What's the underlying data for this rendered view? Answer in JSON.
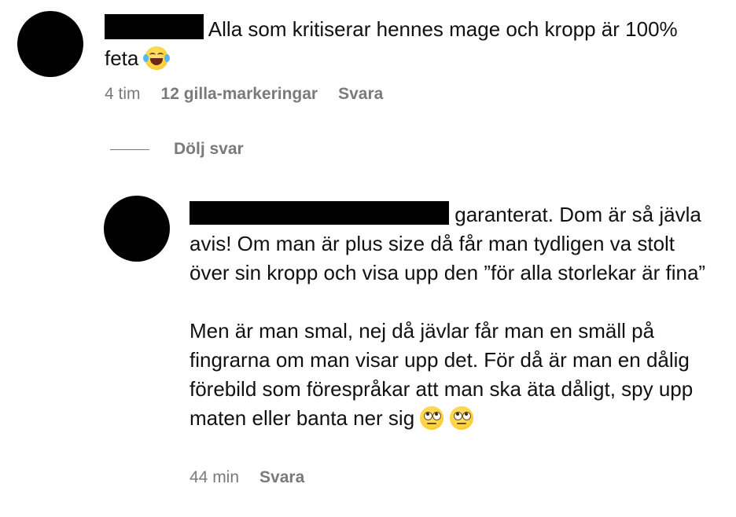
{
  "comment": {
    "text": "Alla som kritiserar hennes mage och kropp är 100% feta",
    "emoji": "face-with-tears-of-joy",
    "time": "4 tim",
    "likes": "12 gilla-markeringar",
    "reply_label": "Svara"
  },
  "replies_toggle": {
    "label": "Dölj svar"
  },
  "reply": {
    "text_part1": "garanterat. Dom är så jävla avis! Om man är plus size då får man tydligen va stolt över sin kropp och visa upp den ”för alla storlekar är fina”",
    "text_part2": "Men är man smal, nej då jävlar får man en smäll på fingrarna om man visar upp det. För då är man en dålig förebild som förespråkar att man ska äta dåligt, spy upp maten eller banta ner sig",
    "emojis": [
      "face-with-rolling-eyes",
      "face-with-rolling-eyes"
    ],
    "time": "44 min",
    "reply_label": "Svara"
  }
}
